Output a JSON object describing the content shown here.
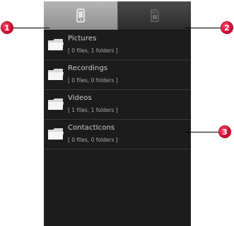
{
  "tabs": [
    {
      "icon": "phone-icon",
      "selected": true
    },
    {
      "icon": "sd-card-icon",
      "selected": false
    }
  ],
  "folders": [
    {
      "name": "Pictures",
      "info": "[ 0 files, 1 folders ]"
    },
    {
      "name": "Recordings",
      "info": "[ 0 files, 0 folders ]"
    },
    {
      "name": "Videos",
      "info": "[ 1 files, 1 folders ]"
    },
    {
      "name": "ContactIcons",
      "info": "[ 0 files, 0 folders ]"
    }
  ],
  "callouts": [
    {
      "number": "1"
    },
    {
      "number": "2"
    },
    {
      "number": "3"
    }
  ],
  "colors": {
    "badge": "#d6002e",
    "background": "#1c1c1c",
    "text": "#cfcfcf"
  }
}
